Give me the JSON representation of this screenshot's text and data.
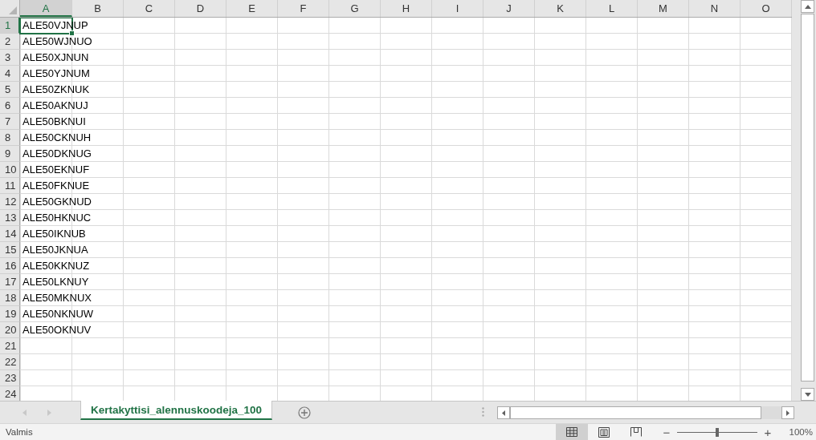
{
  "columns": [
    {
      "label": "A",
      "selected": true
    },
    {
      "label": "B",
      "selected": false
    },
    {
      "label": "C",
      "selected": false
    },
    {
      "label": "D",
      "selected": false
    },
    {
      "label": "E",
      "selected": false
    },
    {
      "label": "F",
      "selected": false
    },
    {
      "label": "G",
      "selected": false
    },
    {
      "label": "H",
      "selected": false
    },
    {
      "label": "I",
      "selected": false
    },
    {
      "label": "J",
      "selected": false
    },
    {
      "label": "K",
      "selected": false
    },
    {
      "label": "L",
      "selected": false
    },
    {
      "label": "M",
      "selected": false
    },
    {
      "label": "N",
      "selected": false
    },
    {
      "label": "O",
      "selected": false
    }
  ],
  "rows": [
    {
      "number": "1",
      "selected": true,
      "cells": [
        {
          "text": "ALE50VJNUP",
          "selected": true
        }
      ]
    },
    {
      "number": "2",
      "selected": false,
      "cells": [
        {
          "text": "ALE50WJNUO",
          "selected": false
        }
      ]
    },
    {
      "number": "3",
      "selected": false,
      "cells": [
        {
          "text": "ALE50XJNUN",
          "selected": false
        }
      ]
    },
    {
      "number": "4",
      "selected": false,
      "cells": [
        {
          "text": "ALE50YJNUM",
          "selected": false
        }
      ]
    },
    {
      "number": "5",
      "selected": false,
      "cells": [
        {
          "text": "ALE50ZKNUK",
          "selected": false
        }
      ]
    },
    {
      "number": "6",
      "selected": false,
      "cells": [
        {
          "text": "ALE50AKNUJ",
          "selected": false
        }
      ]
    },
    {
      "number": "7",
      "selected": false,
      "cells": [
        {
          "text": "ALE50BKNUI",
          "selected": false
        }
      ]
    },
    {
      "number": "8",
      "selected": false,
      "cells": [
        {
          "text": "ALE50CKNUH",
          "selected": false
        }
      ]
    },
    {
      "number": "9",
      "selected": false,
      "cells": [
        {
          "text": "ALE50DKNUG",
          "selected": false
        }
      ]
    },
    {
      "number": "10",
      "selected": false,
      "cells": [
        {
          "text": "ALE50EKNUF",
          "selected": false
        }
      ]
    },
    {
      "number": "11",
      "selected": false,
      "cells": [
        {
          "text": "ALE50FKNUE",
          "selected": false
        }
      ]
    },
    {
      "number": "12",
      "selected": false,
      "cells": [
        {
          "text": "ALE50GKNUD",
          "selected": false
        }
      ]
    },
    {
      "number": "13",
      "selected": false,
      "cells": [
        {
          "text": "ALE50HKNUC",
          "selected": false
        }
      ]
    },
    {
      "number": "14",
      "selected": false,
      "cells": [
        {
          "text": "ALE50IKNUB",
          "selected": false
        }
      ]
    },
    {
      "number": "15",
      "selected": false,
      "cells": [
        {
          "text": "ALE50JKNUA",
          "selected": false
        }
      ]
    },
    {
      "number": "16",
      "selected": false,
      "cells": [
        {
          "text": "ALE50KKNUZ",
          "selected": false
        }
      ]
    },
    {
      "number": "17",
      "selected": false,
      "cells": [
        {
          "text": "ALE50LKNUY",
          "selected": false
        }
      ]
    },
    {
      "number": "18",
      "selected": false,
      "cells": [
        {
          "text": "ALE50MKNUX",
          "selected": false
        }
      ]
    },
    {
      "number": "19",
      "selected": false,
      "cells": [
        {
          "text": "ALE50NKNUW",
          "selected": false
        }
      ]
    },
    {
      "number": "20",
      "selected": false,
      "cells": [
        {
          "text": "ALE50OKNUV",
          "selected": false
        }
      ]
    },
    {
      "number": "21",
      "selected": false,
      "cells": []
    },
    {
      "number": "22",
      "selected": false,
      "cells": []
    },
    {
      "number": "23",
      "selected": false,
      "cells": []
    },
    {
      "number": "24",
      "selected": false,
      "cells": []
    }
  ],
  "sheet_tabs": [
    {
      "label": "Kertakyttisi_alennuskoodeja_100",
      "selected": true
    }
  ],
  "status_bar": {
    "status": "Valmis",
    "views": [
      {
        "kind": "normal",
        "selected": true
      },
      {
        "kind": "page-layout",
        "selected": false
      },
      {
        "kind": "page-break",
        "selected": false
      }
    ],
    "zoom": {
      "minus": "−",
      "plus": "+",
      "level": 0.5,
      "reading": "100%"
    }
  }
}
